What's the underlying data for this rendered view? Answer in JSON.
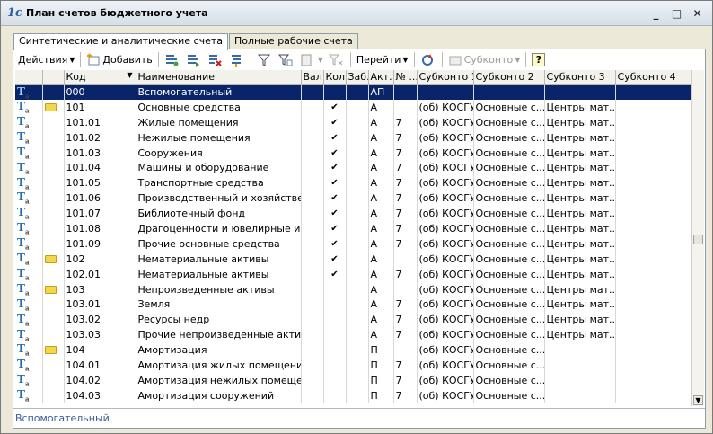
{
  "window": {
    "title": "План счетов бюджетного учета",
    "icon": "1c-icon",
    "controls": [
      "minimize-icon",
      "maximize-icon",
      "close-icon"
    ]
  },
  "tabs": [
    {
      "label": "Синтетические и аналитические счета",
      "active": true
    },
    {
      "label": "Полные рабочие счета",
      "active": false
    }
  ],
  "toolbar": {
    "actions_label": "Действия",
    "add_label": "Добавить",
    "goto_label": "Перейти",
    "subkonto_label": "Субконто",
    "help_label": "?"
  },
  "columns": [
    "",
    "",
    "Код",
    "Наименование",
    "Вал.",
    "Кол.",
    "Заб.",
    "Акт.",
    "№ ...",
    "Субконто 1",
    "Субконто 2",
    "Субконто 3",
    "Субконто 4"
  ],
  "rows": [
    {
      "icon": "t",
      "folder": false,
      "code": "000",
      "name": "Вспомогательный",
      "val": "",
      "kol": "",
      "zab": "",
      "akt": "АП",
      "num": "",
      "s1": "",
      "s2": "",
      "s3": "",
      "s4": "",
      "selected": true
    },
    {
      "icon": "t",
      "folder": true,
      "code": "101",
      "name": "Основные средства",
      "val": "",
      "kol": "✔",
      "zab": "",
      "akt": "А",
      "num": "",
      "s1": "(об) КОСГУ",
      "s2": "Основные с...",
      "s3": "Центры мат...",
      "s4": ""
    },
    {
      "icon": "t",
      "folder": false,
      "code": "101.01",
      "name": "Жилые помещения",
      "val": "",
      "kol": "✔",
      "zab": "",
      "akt": "А",
      "num": "7",
      "s1": "(об) КОСГУ",
      "s2": "Основные с...",
      "s3": "Центры мат...",
      "s4": ""
    },
    {
      "icon": "t",
      "folder": false,
      "code": "101.02",
      "name": "Нежилые помещения",
      "val": "",
      "kol": "✔",
      "zab": "",
      "akt": "А",
      "num": "7",
      "s1": "(об) КОСГУ",
      "s2": "Основные с...",
      "s3": "Центры мат...",
      "s4": ""
    },
    {
      "icon": "t",
      "folder": false,
      "code": "101.03",
      "name": "Сооружения",
      "val": "",
      "kol": "✔",
      "zab": "",
      "akt": "А",
      "num": "7",
      "s1": "(об) КОСГУ",
      "s2": "Основные с...",
      "s3": "Центры мат...",
      "s4": ""
    },
    {
      "icon": "t",
      "folder": false,
      "code": "101.04",
      "name": "Машины и оборудование",
      "val": "",
      "kol": "✔",
      "zab": "",
      "akt": "А",
      "num": "7",
      "s1": "(об) КОСГУ",
      "s2": "Основные с...",
      "s3": "Центры мат...",
      "s4": ""
    },
    {
      "icon": "t",
      "folder": false,
      "code": "101.05",
      "name": "Транспортные средства",
      "val": "",
      "kol": "✔",
      "zab": "",
      "akt": "А",
      "num": "7",
      "s1": "(об) КОСГУ",
      "s2": "Основные с...",
      "s3": "Центры мат...",
      "s4": ""
    },
    {
      "icon": "t",
      "folder": false,
      "code": "101.06",
      "name": "Производственный и хозяйствен...",
      "val": "",
      "kol": "✔",
      "zab": "",
      "akt": "А",
      "num": "7",
      "s1": "(об) КОСГУ",
      "s2": "Основные с...",
      "s3": "Центры мат...",
      "s4": ""
    },
    {
      "icon": "t",
      "folder": false,
      "code": "101.07",
      "name": "Библиотечный фонд",
      "val": "",
      "kol": "✔",
      "zab": "",
      "akt": "А",
      "num": "7",
      "s1": "(об) КОСГУ",
      "s2": "Основные с...",
      "s3": "Центры мат...",
      "s4": ""
    },
    {
      "icon": "t",
      "folder": false,
      "code": "101.08",
      "name": "Драгоценности и ювелирные изд...",
      "val": "",
      "kol": "✔",
      "zab": "",
      "akt": "А",
      "num": "7",
      "s1": "(об) КОСГУ",
      "s2": "Основные с...",
      "s3": "Центры мат...",
      "s4": ""
    },
    {
      "icon": "t",
      "folder": false,
      "code": "101.09",
      "name": "Прочие основные средства",
      "val": "",
      "kol": "✔",
      "zab": "",
      "akt": "А",
      "num": "7",
      "s1": "(об) КОСГУ",
      "s2": "Основные с...",
      "s3": "Центры мат...",
      "s4": ""
    },
    {
      "icon": "t",
      "folder": true,
      "code": "102",
      "name": "Нематериальные активы",
      "val": "",
      "kol": "✔",
      "zab": "",
      "akt": "А",
      "num": "",
      "s1": "(об) КОСГУ",
      "s2": "Основные с...",
      "s3": "Центры мат...",
      "s4": ""
    },
    {
      "icon": "t",
      "folder": false,
      "code": "102.01",
      "name": "Нематериальные активы",
      "val": "",
      "kol": "✔",
      "zab": "",
      "akt": "А",
      "num": "7",
      "s1": "(об) КОСГУ",
      "s2": "Основные с...",
      "s3": "Центры мат...",
      "s4": ""
    },
    {
      "icon": "t",
      "folder": true,
      "code": "103",
      "name": "Непроизведенные активы",
      "val": "",
      "kol": "",
      "zab": "",
      "akt": "А",
      "num": "",
      "s1": "(об) КОСГУ",
      "s2": "Основные с...",
      "s3": "Центры мат...",
      "s4": ""
    },
    {
      "icon": "t",
      "folder": false,
      "code": "103.01",
      "name": "Земля",
      "val": "",
      "kol": "",
      "zab": "",
      "akt": "А",
      "num": "7",
      "s1": "(об) КОСГУ",
      "s2": "Основные с...",
      "s3": "Центры мат...",
      "s4": ""
    },
    {
      "icon": "t",
      "folder": false,
      "code": "103.02",
      "name": "Ресурсы недр",
      "val": "",
      "kol": "",
      "zab": "",
      "akt": "А",
      "num": "7",
      "s1": "(об) КОСГУ",
      "s2": "Основные с...",
      "s3": "Центры мат...",
      "s4": ""
    },
    {
      "icon": "t",
      "folder": false,
      "code": "103.03",
      "name": "Прочие непроизведенные активы",
      "val": "",
      "kol": "",
      "zab": "",
      "akt": "А",
      "num": "7",
      "s1": "(об) КОСГУ",
      "s2": "Основные с...",
      "s3": "Центры мат...",
      "s4": ""
    },
    {
      "icon": "t",
      "folder": true,
      "code": "104",
      "name": "Амортизация",
      "val": "",
      "kol": "",
      "zab": "",
      "akt": "П",
      "num": "",
      "s1": "(об) КОСГУ",
      "s2": "Основные с...",
      "s3": "",
      "s4": ""
    },
    {
      "icon": "t",
      "folder": false,
      "code": "104.01",
      "name": "Амортизация жилых помещений",
      "val": "",
      "kol": "",
      "zab": "",
      "akt": "П",
      "num": "7",
      "s1": "(об) КОСГУ",
      "s2": "Основные с...",
      "s3": "",
      "s4": ""
    },
    {
      "icon": "t",
      "folder": false,
      "code": "104.02",
      "name": "Амортизация нежилых помещений",
      "val": "",
      "kol": "",
      "zab": "",
      "akt": "П",
      "num": "7",
      "s1": "(об) КОСГУ",
      "s2": "Основные с...",
      "s3": "",
      "s4": ""
    },
    {
      "icon": "t",
      "folder": false,
      "code": "104.03",
      "name": "Амортизация сооружений",
      "val": "",
      "kol": "",
      "zab": "",
      "akt": "П",
      "num": "7",
      "s1": "(об) КОСГУ",
      "s2": "Основные с...",
      "s3": "",
      "s4": ""
    }
  ],
  "status_text": "Вспомогательный",
  "colors": {
    "selection": "#0A246A",
    "status_text": "#3A5A9A"
  }
}
